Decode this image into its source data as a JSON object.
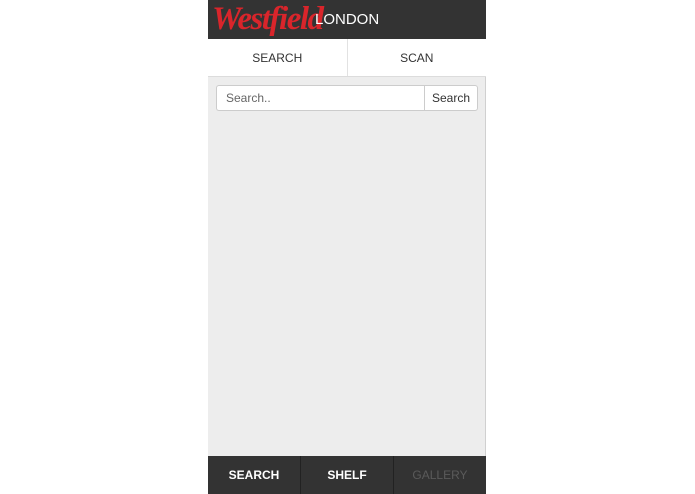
{
  "header": {
    "brand": "Westfield",
    "city": "LONDON",
    "brand_color": "#d9252b",
    "background_color": "#333333"
  },
  "tabs": [
    {
      "label": "SEARCH"
    },
    {
      "label": "SCAN"
    }
  ],
  "search": {
    "placeholder": "Search..",
    "value": "",
    "button_label": "Search"
  },
  "bottom_nav": [
    {
      "label": "SEARCH",
      "enabled": true
    },
    {
      "label": "SHELF",
      "enabled": true
    },
    {
      "label": "GALLERY",
      "enabled": false
    }
  ]
}
